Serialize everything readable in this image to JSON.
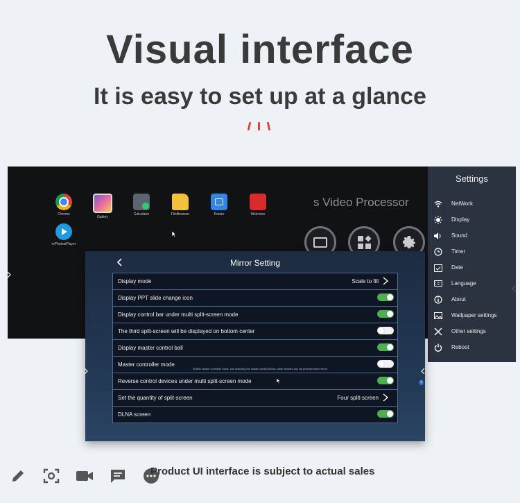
{
  "headline": "Visual interface",
  "subheadline": "It is easy to set up at a glance",
  "desktop": {
    "brand_text": "s Video Processor",
    "apps": [
      {
        "label": "Chrome",
        "icon": "chrome-icon"
      },
      {
        "label": "Gallery",
        "icon": "gallery-icon"
      },
      {
        "label": "Calculator",
        "icon": "calculator-icon"
      },
      {
        "label": "FileBrowser",
        "icon": "folder-icon"
      },
      {
        "label": "Rotate",
        "icon": "rotate-icon"
      },
      {
        "label": "Welcome",
        "icon": "welcome-icon"
      },
      {
        "label": "mPhotosiPlayer",
        "icon": "play-icon"
      }
    ]
  },
  "settings": {
    "title": "Settings",
    "items": [
      {
        "label": "NetWork",
        "icon": "wifi-icon"
      },
      {
        "label": "Display",
        "icon": "brightness-icon"
      },
      {
        "label": "Sound",
        "icon": "speaker-icon"
      },
      {
        "label": "Timer",
        "icon": "clock-icon"
      },
      {
        "label": "Date",
        "icon": "calendar-icon"
      },
      {
        "label": "Language",
        "icon": "keyboard-icon"
      },
      {
        "label": "About",
        "icon": "info-icon"
      },
      {
        "label": "Wallpaper settings",
        "icon": "image-icon"
      },
      {
        "label": "Other settings",
        "icon": "tools-icon"
      },
      {
        "label": "Reboot",
        "icon": "power-icon"
      }
    ]
  },
  "mirror": {
    "title": "Mirror Setting",
    "rows": [
      {
        "label": "Display mode",
        "value": "Scale to fill",
        "type": "select"
      },
      {
        "label": "Display PPT slide change icon",
        "type": "toggle",
        "on": true
      },
      {
        "label": "Display control bar under multi split-screen mode",
        "type": "toggle",
        "on": true
      },
      {
        "label": "The third split-screen will be displayed on bottom center",
        "type": "toggle",
        "on": false
      },
      {
        "label": "Display master control ball",
        "type": "toggle",
        "on": true
      },
      {
        "label": "Master controller mode",
        "type": "toggle",
        "on": false,
        "hint": "Enable master controller mode, can matching the master control device, other devices can not preempt when mirror."
      },
      {
        "label": "Reverse control devices under multi split-screen mode",
        "type": "toggle",
        "on": true
      },
      {
        "label": "Set the quantity of split-screen",
        "value": "Four split-screen",
        "type": "select"
      },
      {
        "label": "DLNA screen",
        "type": "toggle",
        "on": true
      }
    ]
  },
  "footer": "Product UI interface is subject to actual sales",
  "badge": "1",
  "colors": {
    "accent_red": "#d44a3a",
    "toggle_on": "#4caf50",
    "panel_bg": "#2c3340"
  }
}
